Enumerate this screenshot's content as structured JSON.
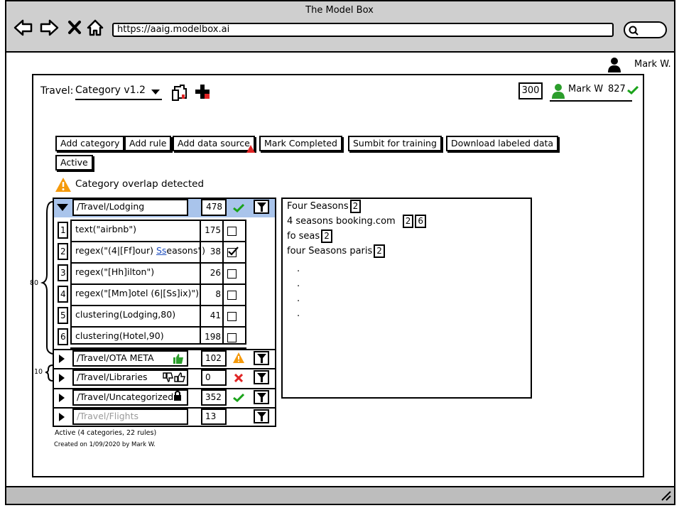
{
  "app": {
    "title": "The Model Box",
    "url": "https://aaig.modelbox.ai"
  },
  "user": {
    "name": "Mark W."
  },
  "header": {
    "prefix": "Travel:",
    "model": "Category v1.2",
    "count": "300",
    "annotator": "Mark W",
    "annotator_count": "827"
  },
  "toolbar": {
    "buttons": [
      "Add category",
      "Add rule",
      "Add data source",
      "Mark Completed",
      "Sumbit for training",
      "Download labeled data"
    ],
    "active": "Active"
  },
  "alert": "Category overlap detected",
  "categories": [
    {
      "path": "/Travel/Lodging",
      "count": "478",
      "status": "ok"
    },
    {
      "path": "/Travel/OTA META",
      "count": "102",
      "status": "warn"
    },
    {
      "path": "/Travel/Libraries",
      "count": "0",
      "status": "error"
    },
    {
      "path": "/Travel/Uncategorized",
      "count": "352",
      "status": "ok"
    },
    {
      "path": "/Travel/Flights",
      "count": "13",
      "status": "none"
    }
  ],
  "rules": [
    {
      "n": "1",
      "text": "text(\"airbnb\")",
      "count": "175",
      "checked": false
    },
    {
      "n": "2",
      "text_a": "regex(\"(4|[Ff]our) ",
      "text_b": "Ss",
      "text_c": "easons\")",
      "count": "38",
      "checked": true
    },
    {
      "n": "3",
      "text": "regex(\"[Hh]ilton\")",
      "count": "26",
      "checked": false
    },
    {
      "n": "4",
      "text": "regex(\"[Mm]otel (6|[Ss]ix)\")",
      "count": "8",
      "checked": false
    },
    {
      "n": "5",
      "text": "clustering(Lodging,80)",
      "count": "41",
      "checked": false
    },
    {
      "n": "6",
      "text": "clustering(Hotel,90)",
      "count": "198",
      "checked": false
    }
  ],
  "bracket_labels": {
    "rules": "80",
    "sub": "10"
  },
  "results": [
    {
      "text": "Four Seasons",
      "badges": [
        "2"
      ]
    },
    {
      "text": "4 seasons booking.com",
      "badges": [
        "2",
        "6"
      ]
    },
    {
      "text": "fo seas",
      "badges": [
        "2"
      ]
    },
    {
      "text": "four Seasons paris",
      "badges": [
        "2"
      ]
    }
  ],
  "footer": {
    "summary": "Active (4 categories, 22 rules)",
    "created": "Created on 1/09/2020 by Mark W."
  },
  "colors": {
    "selected_row": "#a9c4eb",
    "ok": "#1aa31a",
    "warn": "#f59a0c",
    "error": "#e02424",
    "thumb": "#2c9e2c"
  }
}
